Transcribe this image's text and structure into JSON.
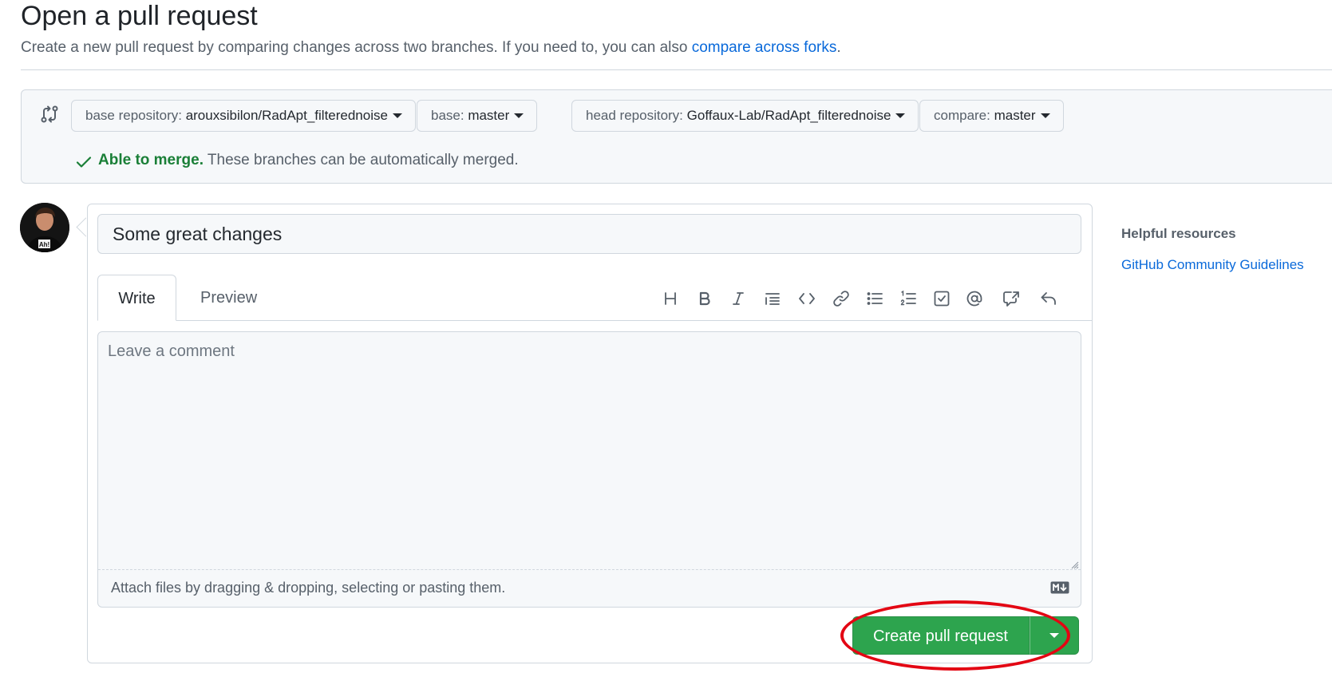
{
  "header": {
    "title": "Open a pull request",
    "subtitle_prefix": "Create a new pull request by comparing changes across two branches. If you need to, you can also ",
    "subtitle_link": "compare across forks",
    "subtitle_suffix": "."
  },
  "compare": {
    "base_repo_label": "base repository: ",
    "base_repo_value": "arouxsibilon/RadApt_filterednoise",
    "base_label": "base: ",
    "base_value": "master",
    "head_repo_label": "head repository: ",
    "head_repo_value": "Goffaux-Lab/RadApt_filterednoise",
    "compare_label": "compare: ",
    "compare_value": "master",
    "merge_status": "Able to merge.",
    "merge_message": " These branches can be automatically merged."
  },
  "form": {
    "title_value": "Some great changes",
    "tabs": {
      "write": "Write",
      "preview": "Preview"
    },
    "comment_placeholder": "Leave a comment",
    "attach_text": "Attach files by dragging & dropping, selecting or pasting them.",
    "submit_label": "Create pull request",
    "toolbar": [
      "heading",
      "bold",
      "italic",
      "quote",
      "code",
      "link",
      "unordered-list",
      "ordered-list",
      "task-list",
      "mention",
      "cross-reference",
      "reply"
    ]
  },
  "sidebar": {
    "heading": "Helpful resources",
    "link": "GitHub Community Guidelines"
  },
  "colors": {
    "accent_link": "#0969da",
    "success": "#1a7f37",
    "primary_button": "#2da44e",
    "highlight": "#e30613"
  }
}
